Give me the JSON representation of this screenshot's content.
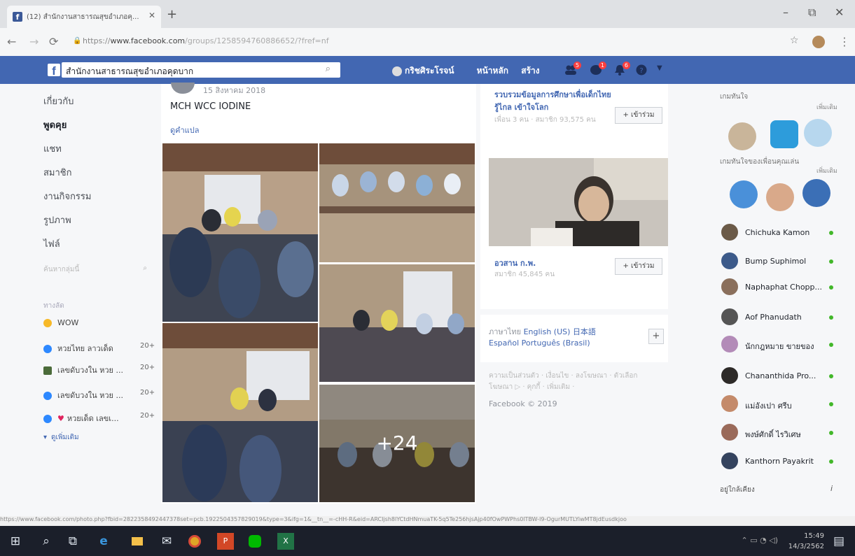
{
  "browser": {
    "tab_title": "(12) สำนักงานสาธารณสุขอำเภอคุ...",
    "url_prefix": "https://",
    "url_domain": "www.facebook.com",
    "url_path": "/groups/1258594760886652/?fref=nf"
  },
  "fb_header": {
    "search_value": "สำนักงานสาธารณสุขอำเภอคุดบาก",
    "profile_name": "กริชศิระโรจน์",
    "home": "หน้าหลัก",
    "create": "สร้าง",
    "badges": [
      "5",
      "1",
      "6"
    ]
  },
  "left_nav": {
    "items": [
      "เกี่ยวกับ",
      "พูดคุย",
      "แชท",
      "สมาชิก",
      "งานกิจกรรม",
      "รูปภาพ",
      "ไฟล์"
    ],
    "search_placeholder": "ค้นหากลุ่มนี้",
    "shortcuts_title": "ทางลัด",
    "shortcuts": [
      {
        "label": "WOW",
        "count": ""
      },
      {
        "label": "หวยไทย ลาวเด็ด",
        "count": "20+"
      },
      {
        "label": "เลขดับวงใน หวย ...",
        "count": "20+"
      },
      {
        "label": "เลขดับวงใน หวย ...",
        "count": "20+"
      },
      {
        "label": "หวยเด็ด เลขเ...",
        "count": "20+"
      }
    ],
    "see_more": "ดูเพิ่มเติม"
  },
  "post": {
    "date": "15 สิงหาคม 2018",
    "text": "MCH  WCC  IODINE",
    "translate": "ดูคำแปล",
    "more_photos": "+24"
  },
  "suggested_groups": [
    {
      "title": "รวบรวมข้อมูลการศึกษาเพื่อเด็กไทย รู้ไกล เข้าใจโลก",
      "meta": "เพื่อน 3 คน · สมาชิก 93,575 คน",
      "join": "+ เข้าร่วม"
    },
    {
      "title": "อวสาน ก.พ.",
      "meta": "สมาชิก 45,845 คน",
      "join": "+ เข้าร่วม"
    }
  ],
  "languages": {
    "current": "ภาษาไทย",
    "others": [
      "English (US)",
      "日本語",
      "Español",
      "Português (Brasil)"
    ],
    "plus": "+"
  },
  "footer": {
    "links": "ความเป็นส่วนตัว · เงื่อนไข · ลงโฆษณา · ตัวเลือกโฆษณา ▷ · คุกกี้ · เพิ่มเติม ·",
    "copyright": "Facebook © 2019"
  },
  "right_rail": {
    "games_title": "เกมทันใจ",
    "games_more": "เพิ่มเติม",
    "friends_games_title": "เกมทันใจของเพื่อนคุณเล่น",
    "friends_games_more": "เพิ่มเติม",
    "contacts": [
      "Chichuka Kamon",
      "Bump Suphimol",
      "Naphaphat Chopp...",
      "Aof Phanudath",
      "นักกฎหมาย ขายของ",
      "Chananthida Pro...",
      "แม่อังเปา ศรีบ",
      "พงษ์ศักดิ์ ไรวิเศษ",
      "Kanthorn Payakrit"
    ],
    "nearby": "อยู่ใกล้เคียง"
  },
  "status_url": "https://www.facebook.com/photo.php?fbid=2822358492447378set=pcb.1922504357829019&type=3&ifg=1&__tn__=-cHH-R&eid=ARCIjsh8lYCtdHNmuaTK-5q5Te256hjsAjp40fOwPWPhs0lTBW-l9-OgurMUTLYiwMT8jdEusdkjoo",
  "taskbar": {
    "time": "15:49",
    "date": "14/3/2562"
  },
  "colors": {
    "fb_blue": "#4267b2",
    "taskbar": "#1b1f2a"
  }
}
